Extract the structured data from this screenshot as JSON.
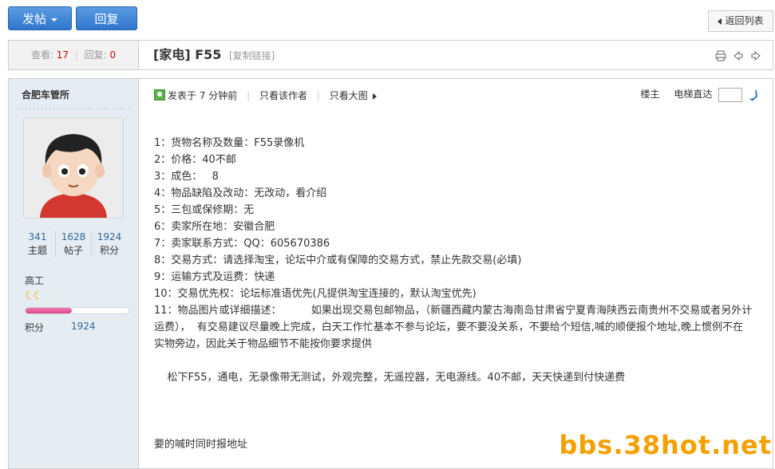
{
  "toolbar": {
    "post_label": "发帖",
    "reply_label": "回复",
    "back_label": "返回列表"
  },
  "header": {
    "views_label": "查看:",
    "views": "17",
    "replies_label": "回复:",
    "replies": "0",
    "title": "[家电] F55",
    "copy_link": "[复制链接]"
  },
  "author": {
    "name": "合肥车管所",
    "stats": [
      {
        "value": "341",
        "label": "主题"
      },
      {
        "value": "1628",
        "label": "帖子"
      },
      {
        "value": "1924",
        "label": "积分"
      }
    ],
    "group": "高工",
    "moons": "☾☾",
    "credit_label": "积分",
    "credit_value": "1924",
    "credit_progress": 0.45
  },
  "post": {
    "posted": "发表于 7 分钟前",
    "only_author": "只看该作者",
    "big_image": "只看大图",
    "floor": "楼主",
    "jump_label": "电梯直达",
    "lines": [
      "1：货物名称及数量：F55录像机",
      "2：价格：40不邮",
      "3：成色：   8",
      "4：物品缺陷及改动：无改动，看介绍",
      "5：三包或保修期：无",
      "6：卖家所在地：安徽合肥",
      "7：卖家联系方式：QQ：605670386",
      "8：交易方式：请选择淘宝，论坛中介或有保障的交易方式，禁止先款交易(必填)",
      "9：运输方式及运费：快递",
      "10：交易优先权：论坛标准语优先(凡提供淘宝连接的，默认淘宝优先)",
      "11：物品图片或详细描述：         如果出现交易包邮物品，（新疆西藏内蒙古海南岛甘肃省宁夏青海陕西云南贵州不交易或者另外计运费），  有交易建议尽量晚上完成，白天工作忙基本不参与论坛，要不要没关系，不要给个短信,喊的顺便报个地址,晚上惯例不在实物旁边，因此关于物品细节不能按你要求提供",
      "",
      "    松下F55，通电，无录像带无测试，外观完整，无遥控器，无电源线。40不邮，天天快递到付快递费",
      "",
      "",
      "",
      "要的喊时同时报地址"
    ]
  },
  "watermark": "bbs.38hot.net"
}
